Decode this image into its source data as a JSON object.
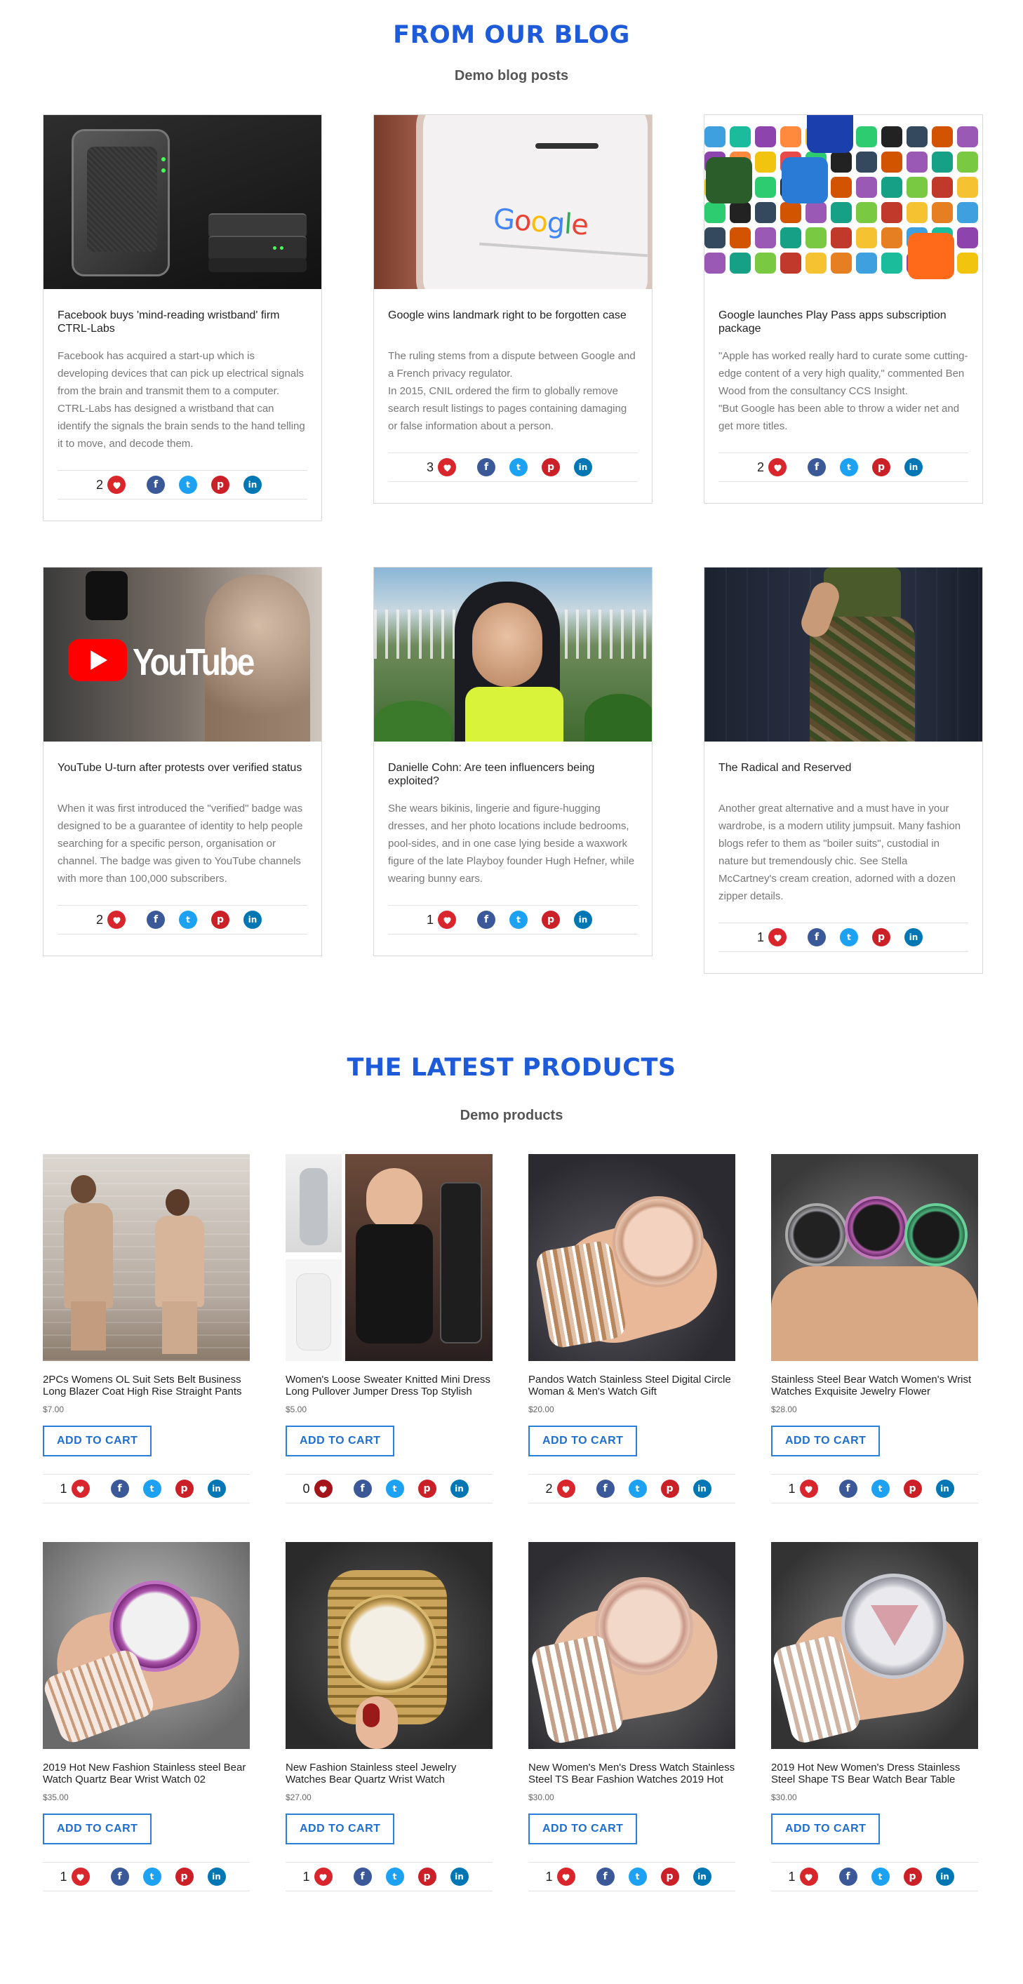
{
  "blog": {
    "title": "FROM OUR BLOG",
    "subtitle": "Demo blog posts",
    "posts": [
      {
        "title": "Facebook buys 'mind-reading wristband' firm CTRL-Labs",
        "text": [
          "Facebook has acquired a start-up which is developing devices that can pick up electrical signals from the brain and transmit them to a computer.",
          "CTRL-Labs has designed a wristband that can identify the signals the brain sends to the hand telling it to move, and decode them."
        ],
        "likes": "2"
      },
      {
        "title": "Google wins landmark right to be forgotten case",
        "text": [
          "The ruling stems from a dispute between Google and a French privacy regulator.",
          "In 2015, CNIL ordered the firm to globally remove search result listings to pages containing damaging or false information about a person."
        ],
        "likes": "3",
        "img_text": "Google"
      },
      {
        "title": "Google launches Play Pass apps subscription package",
        "text": [
          "\"Apple has worked really hard to curate some cutting-edge content of a very high quality,\" commented Ben Wood from the consultancy CCS Insight.",
          "\"But Google has been able to throw a wider net and get more titles."
        ],
        "likes": "2"
      },
      {
        "title": "YouTube U-turn after protests over verified status",
        "text": [
          "When it was first introduced the \"verified\" badge was designed to be a guarantee of identity to help people searching for a specific person, organisation or channel. The badge was given to YouTube channels with more than 100,000 subscribers."
        ],
        "likes": "2",
        "img_text": "YouTube"
      },
      {
        "title": "Danielle Cohn: Are teen influencers being exploited?",
        "text": [
          "She wears bikinis, lingerie and figure-hugging dresses, and her photo locations include bedrooms, pool-sides, and in one case lying beside a waxwork figure of the late Playboy founder Hugh Hefner, while wearing bunny ears."
        ],
        "likes": "1"
      },
      {
        "title": "The Radical and Reserved",
        "text": [
          "Another great alternative and a must have in your wardrobe, is a modern utility jumpsuit. Many fashion blogs refer to them as \"boiler suits\", custodial in nature but tremendously chic. See Stella McCartney's cream creation, adorned with a dozen zipper details."
        ],
        "likes": "1"
      }
    ]
  },
  "products": {
    "title": "THE LATEST PRODUCTS",
    "subtitle": "Demo products",
    "cart_label": "ADD TO CART",
    "items": [
      {
        "name": "2PCs Womens OL Suit Sets Belt Business Long Blazer Coat High Rise Straight Pants",
        "price": "$7.00",
        "likes": "1"
      },
      {
        "name": "Women's Loose Sweater Knitted Mini Dress Long Pullover Jumper Dress Top Stylish",
        "price": "$5.00",
        "likes": "0"
      },
      {
        "name": "Pandos Watch Stainless Steel Digital Circle Woman & Men's Watch Gift",
        "price": "$20.00",
        "likes": "2"
      },
      {
        "name": "Stainless Steel Bear Watch Women's Wrist Watches Exquisite Jewelry Flower",
        "price": "$28.00",
        "likes": "1"
      },
      {
        "name": "2019 Hot New Fashion Stainless steel Bear Watch Quartz Bear Wrist Watch 02",
        "price": "$35.00",
        "likes": "1"
      },
      {
        "name": "New Fashion Stainless steel Jewelry Watches Bear Quartz Wrist Watch",
        "price": "$27.00",
        "likes": "1"
      },
      {
        "name": "New Women's Men's Dress Watch Stainless Steel TS Bear Fashion Watches 2019 Hot",
        "price": "$30.00",
        "likes": "1"
      },
      {
        "name": "2019 Hot New Women's Dress Stainless Steel Shape TS Bear Watch Bear Table",
        "price": "$30.00",
        "likes": "1"
      }
    ]
  },
  "social": {
    "facebook": "f",
    "twitter": "t",
    "pinterest": "p",
    "linkedin": "in"
  },
  "colors": {
    "accent": "#1e5bd8",
    "heart": "#d8262c",
    "facebook": "#3b5998",
    "twitter": "#1da1f2",
    "pinterest": "#cb2027",
    "linkedin": "#0077b5"
  }
}
